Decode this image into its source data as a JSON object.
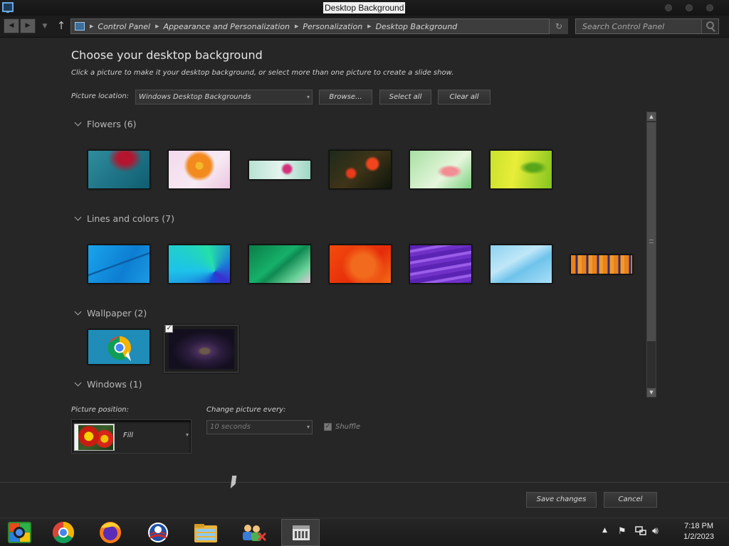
{
  "window": {
    "title": "Desktop Background"
  },
  "address_bar": {
    "breadcrumb": [
      "Control Panel",
      "Appearance and Personalization",
      "Personalization",
      "Desktop Background"
    ],
    "search_placeholder": "Search Control Panel"
  },
  "main": {
    "heading": "Choose your desktop background",
    "subheading": "Click a picture to make it your desktop background, or select more than one picture to create a slide show.",
    "picture_location_label": "Picture location:",
    "picture_location_value": "Windows Desktop Backgrounds",
    "browse_label": "Browse...",
    "select_all_label": "Select all",
    "clear_all_label": "Clear all"
  },
  "groups": [
    {
      "title": "Flowers (6)",
      "count": 6
    },
    {
      "title": "Lines and colors (7)",
      "count": 7
    },
    {
      "title": "Wallpaper (2)",
      "count": 2,
      "selected_index": 1
    },
    {
      "title": "Windows (1)",
      "count": 1
    }
  ],
  "options": {
    "picture_position_label": "Picture position:",
    "picture_position_value": "Fill",
    "change_picture_label": "Change picture every:",
    "change_picture_value": "10 seconds",
    "shuffle_label": "Shuffle",
    "shuffle_checked": true
  },
  "footer": {
    "save_label": "Save changes",
    "cancel_label": "Cancel"
  },
  "taskbar": {
    "apps": [
      "start-orb-icon",
      "chrome-icon",
      "firefox-icon",
      "obama-logo-icon",
      "file-explorer-icon",
      "network-users-icon",
      "control-panel-icon"
    ],
    "time": "7:18 PM",
    "date": "1/2/2023"
  },
  "colors": {
    "background": "#262626",
    "titlebar": "#1d1d1d",
    "taskbar": "#1a1a1a"
  }
}
